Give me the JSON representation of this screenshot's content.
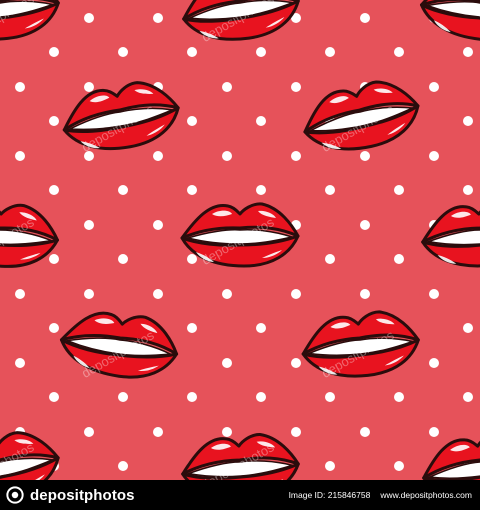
{
  "pattern": {
    "background_color": "#e6525a",
    "dot_color": "#ffffff",
    "lip_fill": "#e8131f",
    "lip_outline": "#2a0c0c",
    "teeth_color": "#ffffff",
    "highlight_color": "#ffffff"
  },
  "watermark": {
    "text": "depositphotos"
  },
  "footer": {
    "brand_name": "depositphotos",
    "brand_icon": "depositphotos-logo-icon",
    "image_id": "Image ID: 215846758",
    "site_url": "www.depositphotos.com"
  }
}
